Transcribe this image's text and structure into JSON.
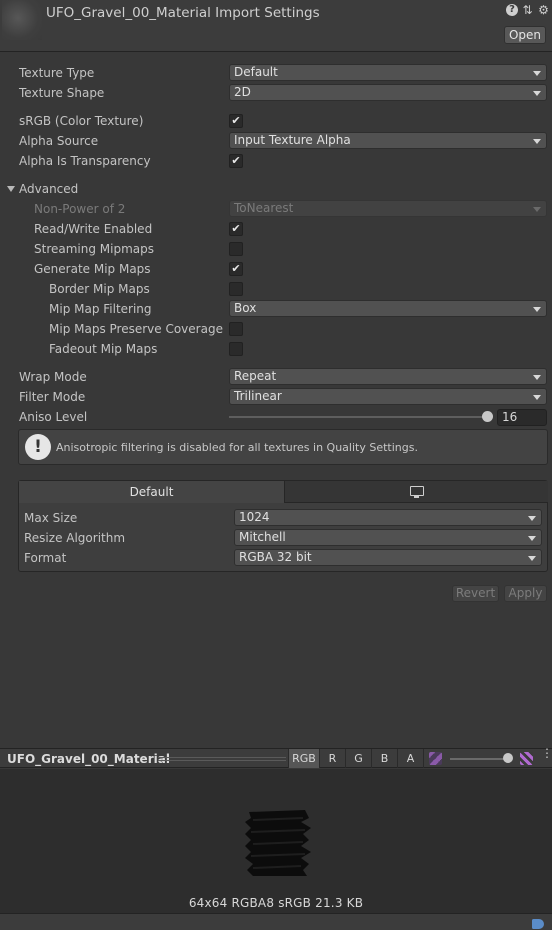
{
  "header": {
    "title": "UFO_Gravel_00_Material Import Settings",
    "help_icon": "?",
    "preset_icon": "⇅",
    "settings_icon": "⚙",
    "open_label": "Open"
  },
  "properties": {
    "texture_type": {
      "label": "Texture Type",
      "value": "Default"
    },
    "texture_shape": {
      "label": "Texture Shape",
      "value": "2D"
    },
    "srgb": {
      "label": "sRGB (Color Texture)",
      "checked": true
    },
    "alpha_source": {
      "label": "Alpha Source",
      "value": "Input Texture Alpha"
    },
    "alpha_transparency": {
      "label": "Alpha Is Transparency",
      "checked": true
    },
    "advanced": {
      "label": "Advanced"
    },
    "non_power_of_2": {
      "label": "Non-Power of 2",
      "value": "ToNearest"
    },
    "read_write": {
      "label": "Read/Write Enabled",
      "checked": true
    },
    "streaming_mipmaps": {
      "label": "Streaming Mipmaps",
      "checked": false
    },
    "generate_mipmaps": {
      "label": "Generate Mip Maps",
      "checked": true
    },
    "border_mipmaps": {
      "label": "Border Mip Maps",
      "checked": false
    },
    "mipmap_filtering": {
      "label": "Mip Map Filtering",
      "value": "Box"
    },
    "mipmaps_preserve_coverage": {
      "label": "Mip Maps Preserve Coverage",
      "checked": false
    },
    "fadeout_mipmaps": {
      "label": "Fadeout Mip Maps",
      "checked": false
    },
    "wrap_mode": {
      "label": "Wrap Mode",
      "value": "Repeat"
    },
    "filter_mode": {
      "label": "Filter Mode",
      "value": "Trilinear"
    },
    "aniso_level": {
      "label": "Aniso Level",
      "value": "16",
      "fraction": 1.0
    }
  },
  "checkmark": "✔",
  "help_box": {
    "icon": "!",
    "text": "Anisotropic filtering is disabled for all textures in Quality Settings."
  },
  "platform": {
    "tab_default": "Default",
    "tab_standalone_icon": "monitor-icon",
    "max_size": {
      "label": "Max Size",
      "value": "1024"
    },
    "resize_algorithm": {
      "label": "Resize Algorithm",
      "value": "Mitchell"
    },
    "format": {
      "label": "Format",
      "value": "RGBA 32 bit"
    }
  },
  "actions": {
    "revert": "Revert",
    "apply": "Apply"
  },
  "preview": {
    "title": "UFO_Gravel_00_Material",
    "channels": [
      "RGB",
      "R",
      "G",
      "B",
      "A"
    ],
    "active_channel": "RGB",
    "mip_level_fraction": 1.0,
    "more_icon": "⋮",
    "info": "64x64  RGBA8 sRGB   21.3 KB"
  },
  "colors": {
    "background": "#383838",
    "dropdown": "#515151",
    "checkmark": "#e8e8e8",
    "preview_bg": "#2d2d2d"
  }
}
